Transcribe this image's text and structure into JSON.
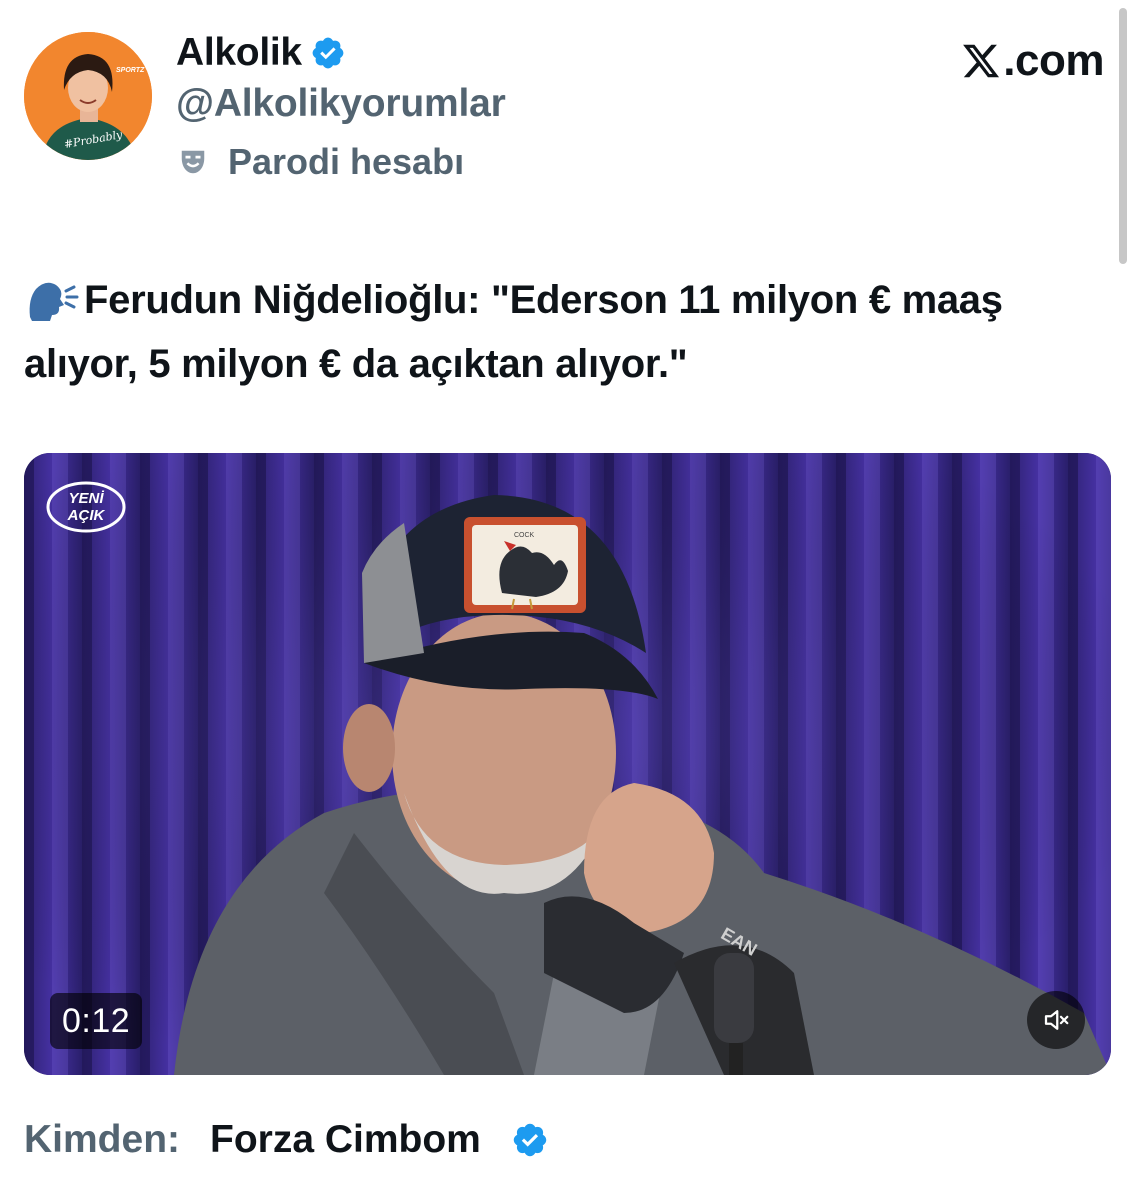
{
  "header": {
    "display_name": "Alkolik",
    "handle": "@Alkolikyorumlar",
    "parody_label": "Parodi hesabı",
    "avatar": {
      "shirt_text": "#Probably",
      "corner_text": "SPORTZ"
    },
    "site_label": ".com"
  },
  "tweet": {
    "text": "Ferudun Niğdelioğlu: \"Ederson 11 milyon € maaş alıyor, 5 milyon € da açıktan alıyor.\""
  },
  "media": {
    "brand_line1": "YENİ",
    "brand_line2": "AÇIK",
    "cap_text": "COCK",
    "jacket_text": "EAN",
    "time": "0:12"
  },
  "footer": {
    "from_label": "Kimden:",
    "from_name": "Forza Cimbom"
  },
  "colors": {
    "verified": "#1d9bf0",
    "muted_text": "#536471",
    "primary_text": "#0f1419",
    "avatar_bg": "#f2862e",
    "curtain": "#3a2a86"
  },
  "icons": {
    "verified": "verified-badge-icon",
    "parody": "theater-mask-icon",
    "speaking": "speaking-head-icon",
    "mute": "speaker-muted-icon",
    "x_logo": "x-logo-icon"
  }
}
